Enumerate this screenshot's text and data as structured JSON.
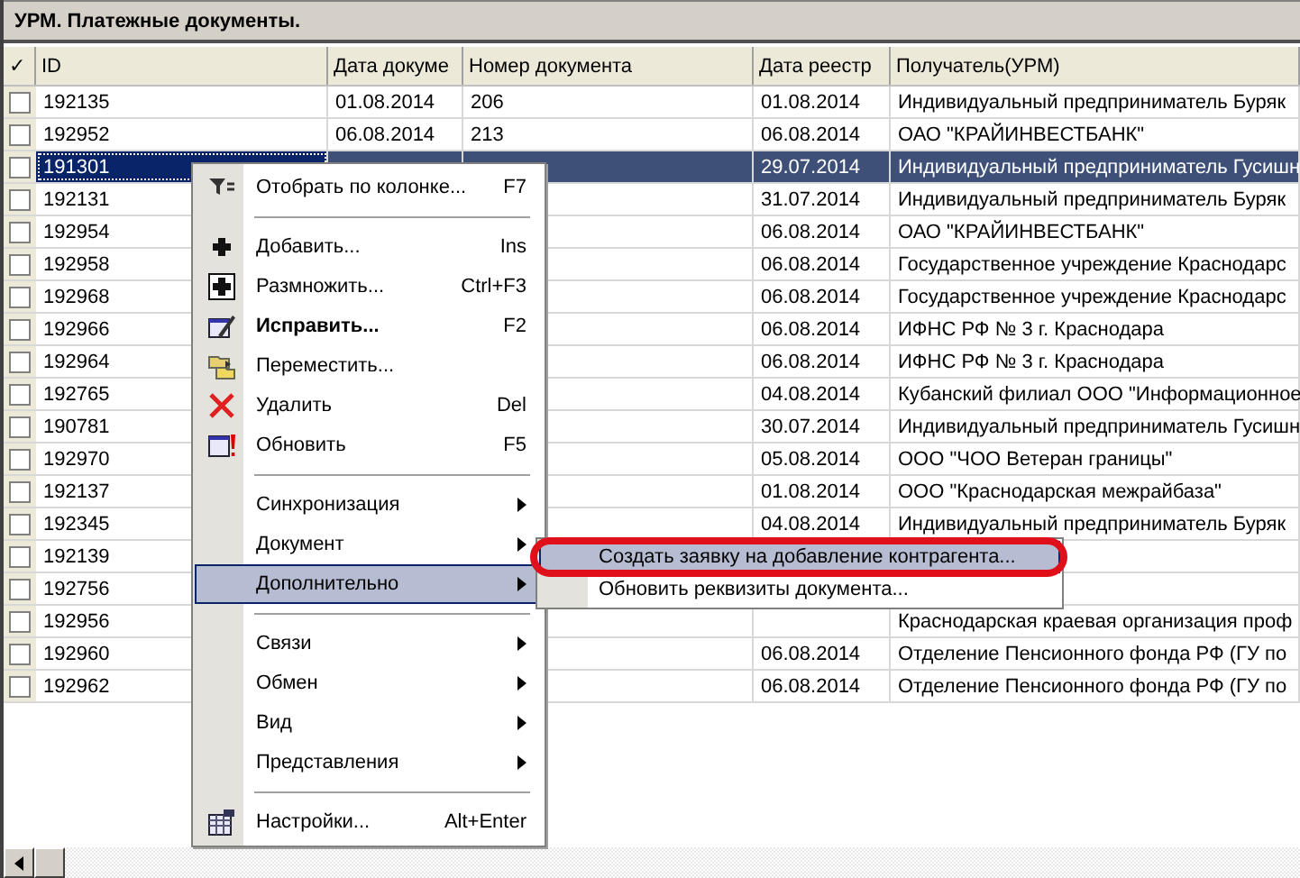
{
  "window": {
    "title": "УРМ. Платежные документы."
  },
  "table": {
    "columns": [
      {
        "label": "✓"
      },
      {
        "label": "ID"
      },
      {
        "label": "Дата докуме"
      },
      {
        "label": "Номер документа"
      },
      {
        "label": "Дата реестр"
      },
      {
        "label": "Получатель(УРМ)"
      }
    ],
    "rows": [
      {
        "checked": false,
        "selected": false,
        "id": "192135",
        "doc_date": "01.08.2014",
        "doc_number": "206",
        "registry_date": "01.08.2014",
        "recipient": "Индивидуальный предприниматель Буряк"
      },
      {
        "checked": false,
        "selected": false,
        "id": "192952",
        "doc_date": "06.08.2014",
        "doc_number": "213",
        "registry_date": "06.08.2014",
        "recipient": "ОАО \"КРАЙИНВЕСТБАНК\""
      },
      {
        "checked": false,
        "selected": true,
        "id": "191301",
        "registry_date": "29.07.2014",
        "recipient": "Индивидуальный предприниматель Гусишн"
      },
      {
        "checked": false,
        "selected": false,
        "id": "192131",
        "registry_date": "31.07.2014",
        "recipient": "Индивидуальный предприниматель Буряк"
      },
      {
        "checked": false,
        "selected": false,
        "id": "192954",
        "registry_date": "06.08.2014",
        "recipient": "ОАО \"КРАЙИНВЕСТБАНК\""
      },
      {
        "checked": false,
        "selected": false,
        "id": "192958",
        "registry_date": "06.08.2014",
        "recipient": "Государственное учреждение Краснодарс"
      },
      {
        "checked": false,
        "selected": false,
        "id": "192968",
        "registry_date": "06.08.2014",
        "recipient": "Государственное учреждение Краснодарс"
      },
      {
        "checked": false,
        "selected": false,
        "id": "192966",
        "registry_date": "06.08.2014",
        "recipient": "ИФНС РФ № 3 г. Краснодара"
      },
      {
        "checked": false,
        "selected": false,
        "id": "192964",
        "registry_date": "06.08.2014",
        "recipient": "ИФНС РФ № 3 г. Краснодара"
      },
      {
        "checked": false,
        "selected": false,
        "id": "192765",
        "registry_date": "04.08.2014",
        "recipient": "Кубанский филиал ООО \"Информационное"
      },
      {
        "checked": false,
        "selected": false,
        "id": "190781",
        "registry_date": "30.07.2014",
        "recipient": "Индивидуальный предприниматель Гусишн"
      },
      {
        "checked": false,
        "selected": false,
        "id": "192970",
        "registry_date": "05.08.2014",
        "recipient": "ООО \"ЧОО Ветеран границы\""
      },
      {
        "checked": false,
        "selected": false,
        "id": "192137",
        "registry_date": "01.08.2014",
        "recipient": "ООО \"Краснодарская межрайбаза\""
      },
      {
        "checked": false,
        "selected": false,
        "id": "192345",
        "registry_date": "04.08.2014",
        "recipient": "Индивидуальный предприниматель Буряк"
      },
      {
        "checked": false,
        "selected": false,
        "id": "192139"
      },
      {
        "checked": false,
        "selected": false,
        "id": "192756"
      },
      {
        "checked": false,
        "selected": false,
        "id": "192956",
        "recipient": "Краснодарская краевая организация проф"
      },
      {
        "checked": false,
        "selected": false,
        "id": "192960",
        "registry_date": "06.08.2014",
        "recipient": "Отделение Пенсионного фонда РФ (ГУ по"
      },
      {
        "checked": false,
        "selected": false,
        "id": "192962",
        "registry_date": "06.08.2014",
        "recipient": "Отделение Пенсионного фонда РФ (ГУ по"
      }
    ]
  },
  "context_menu": {
    "items": [
      {
        "kind": "item",
        "label": "Отобрать по колонке...",
        "shortcut": "F7",
        "default": false,
        "selected": false
      },
      {
        "kind": "separator"
      },
      {
        "kind": "item",
        "label": "Добавить...",
        "shortcut": "Ins",
        "default": false,
        "selected": false
      },
      {
        "kind": "item",
        "label": "Размножить...",
        "shortcut": "Ctrl+F3",
        "default": false,
        "selected": false
      },
      {
        "kind": "item",
        "label": "Исправить...",
        "shortcut": "F2",
        "default": true,
        "selected": false
      },
      {
        "kind": "item",
        "label": "Переместить...",
        "default": false,
        "selected": false
      },
      {
        "kind": "item",
        "label": "Удалить",
        "shortcut": "Del",
        "default": false,
        "selected": false
      },
      {
        "kind": "item",
        "label": "Обновить",
        "shortcut": "F5",
        "default": false,
        "selected": false
      },
      {
        "kind": "separator"
      },
      {
        "kind": "submenu",
        "label": "Синхронизация",
        "default": false,
        "selected": false
      },
      {
        "kind": "submenu",
        "label": "Документ",
        "default": false,
        "selected": false
      },
      {
        "kind": "submenu",
        "label": "Дополнительно",
        "default": false,
        "selected": true
      },
      {
        "kind": "separator"
      },
      {
        "kind": "submenu",
        "label": "Связи",
        "default": false,
        "selected": false
      },
      {
        "kind": "submenu",
        "label": "Обмен",
        "default": false,
        "selected": false
      },
      {
        "kind": "submenu",
        "label": "Вид",
        "default": false,
        "selected": false
      },
      {
        "kind": "submenu",
        "label": "Представления",
        "default": false,
        "selected": false
      },
      {
        "kind": "separator"
      },
      {
        "kind": "item",
        "label": "Настройки...",
        "shortcut": "Alt+Enter",
        "default": false,
        "selected": false
      }
    ]
  },
  "submenu": {
    "items": [
      {
        "label": "Создать заявку на добавление контрагента...",
        "selected": true,
        "circled": true
      },
      {
        "label": "Обновить реквизиты документа...",
        "selected": false,
        "circled": false
      }
    ]
  }
}
